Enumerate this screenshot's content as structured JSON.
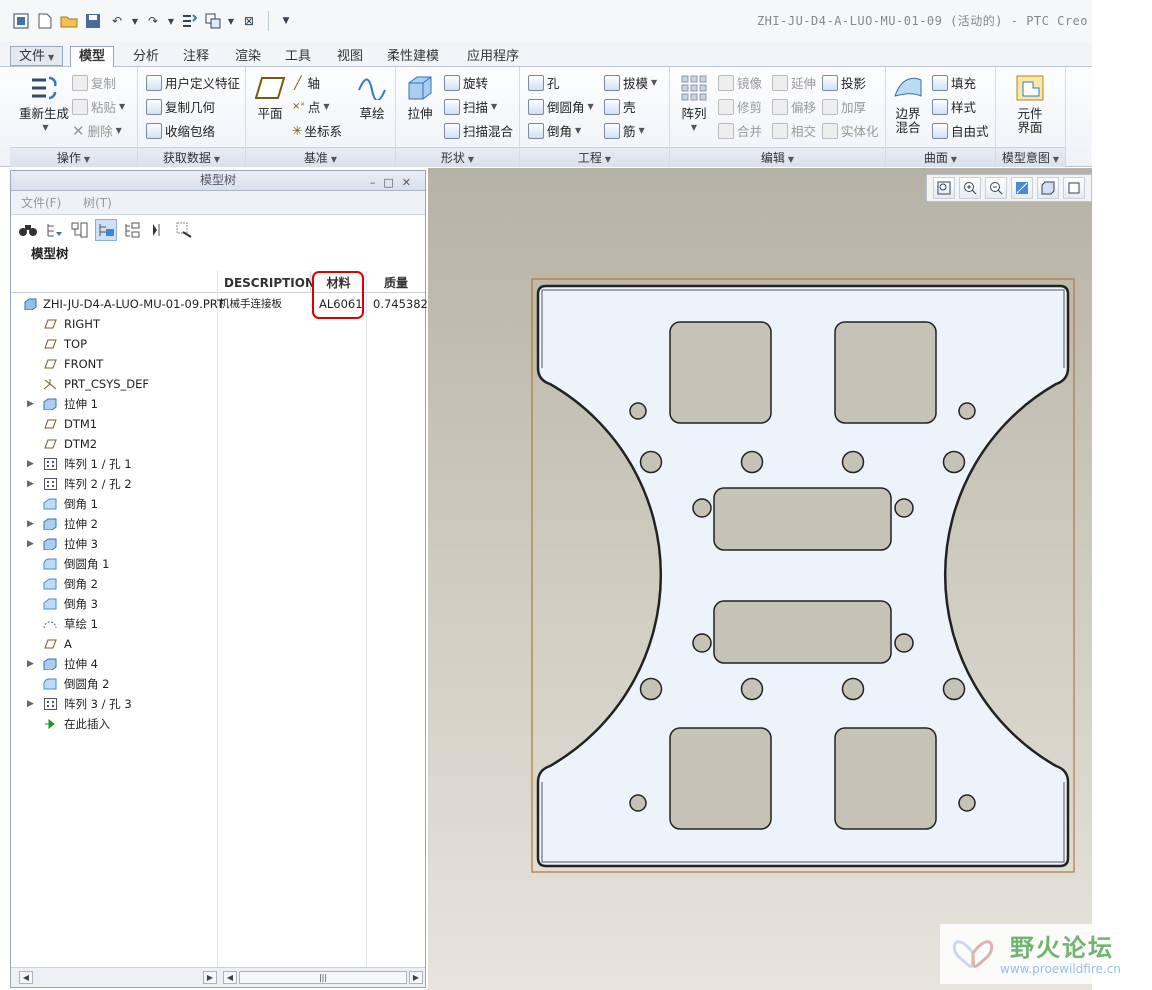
{
  "window": {
    "title": "ZHI-JU-D4-A-LUO-MU-01-09 (活动的) - PTC Creo"
  },
  "tabs": [
    "文件",
    "模型",
    "分析",
    "注释",
    "渲染",
    "工具",
    "视图",
    "柔性建模",
    "应用程序"
  ],
  "ribbon": {
    "operations": {
      "label": "操作",
      "regenerate": "重新生成",
      "copy": "复制",
      "paste": "粘贴",
      "delete": "删除"
    },
    "get_data": {
      "label": "获取数据",
      "udf": "用户定义特征",
      "copy_geom": "复制几何",
      "shrinkwrap": "收缩包络"
    },
    "datum": {
      "label": "基准",
      "plane": "平面",
      "axis": "轴",
      "point": "点",
      "csys": "坐标系",
      "sketch": "草绘"
    },
    "shapes": {
      "label": "形状",
      "extrude": "拉伸",
      "revolve": "旋转",
      "sweep": "扫描",
      "swept_blend": "扫描混合"
    },
    "engineering": {
      "label": "工程",
      "hole": "孔",
      "round": "倒圆角",
      "chamfer": "倒角",
      "draft": "拔模",
      "shell": "壳",
      "rib": "筋"
    },
    "editing": {
      "label": "编辑",
      "pattern": "阵列",
      "mirror": "镜像",
      "trim": "修剪",
      "merge": "合并",
      "extend": "延伸",
      "offset": "偏移",
      "intersect": "相交",
      "project": "投影",
      "thicken": "加厚",
      "solidify": "实体化"
    },
    "surfaces": {
      "label": "曲面",
      "boundary_blend": "边界混合",
      "fill": "填充",
      "style": "样式",
      "freestyle": "自由式"
    },
    "model_intent": {
      "label": "模型意图",
      "component_interface": "元件界面"
    }
  },
  "model_tree": {
    "title": "模型树",
    "menu": [
      "文件(F)",
      "树(T)"
    ],
    "label": "模型树",
    "columns": [
      "DESCRIPTION",
      "材料",
      "质量"
    ],
    "root": {
      "name": "ZHI-JU-D4-A-LUO-MU-01-09.PRT",
      "description": "机械手连接板",
      "material": "AL6061",
      "mass": "0.745382"
    },
    "items": [
      {
        "name": "RIGHT",
        "icon": "datum-plane-icon",
        "expandable": false
      },
      {
        "name": "TOP",
        "icon": "datum-plane-icon",
        "expandable": false
      },
      {
        "name": "FRONT",
        "icon": "datum-plane-icon",
        "expandable": false
      },
      {
        "name": "PRT_CSYS_DEF",
        "icon": "csys-icon",
        "expandable": false
      },
      {
        "name": "拉伸 1",
        "icon": "extrude-icon",
        "expandable": true
      },
      {
        "name": "DTM1",
        "icon": "datum-plane-icon",
        "expandable": false
      },
      {
        "name": "DTM2",
        "icon": "datum-plane-icon",
        "expandable": false
      },
      {
        "name": "阵列 1 / 孔 1",
        "icon": "pattern-icon",
        "expandable": true
      },
      {
        "name": "阵列 2 / 孔 2",
        "icon": "pattern-icon",
        "expandable": true
      },
      {
        "name": "倒角 1",
        "icon": "chamfer-icon",
        "expandable": false
      },
      {
        "name": "拉伸 2",
        "icon": "extrude-icon",
        "expandable": true
      },
      {
        "name": "拉伸 3",
        "icon": "extrude-icon",
        "expandable": true
      },
      {
        "name": "倒圆角 1",
        "icon": "round-icon",
        "expandable": false
      },
      {
        "name": "倒角 2",
        "icon": "chamfer-icon",
        "expandable": false
      },
      {
        "name": "倒角 3",
        "icon": "chamfer-icon",
        "expandable": false
      },
      {
        "name": "草绘 1",
        "icon": "sketch-icon",
        "expandable": false
      },
      {
        "name": "A",
        "icon": "datum-plane-icon",
        "expandable": false
      },
      {
        "name": "拉伸 4",
        "icon": "extrude-icon",
        "expandable": true
      },
      {
        "name": "倒圆角 2",
        "icon": "round-icon",
        "expandable": false
      },
      {
        "name": "阵列 3 / 孔 3",
        "icon": "pattern-icon",
        "expandable": true
      },
      {
        "name": "在此插入",
        "icon": "insert-arrow-icon",
        "expandable": false
      }
    ]
  },
  "watermark": {
    "name": "野火论坛",
    "url": "www.proewildfire.cn"
  },
  "colors": {
    "accent": "#e00000",
    "part_face": "#edf3fb",
    "cutout": "#c6c3b6"
  }
}
